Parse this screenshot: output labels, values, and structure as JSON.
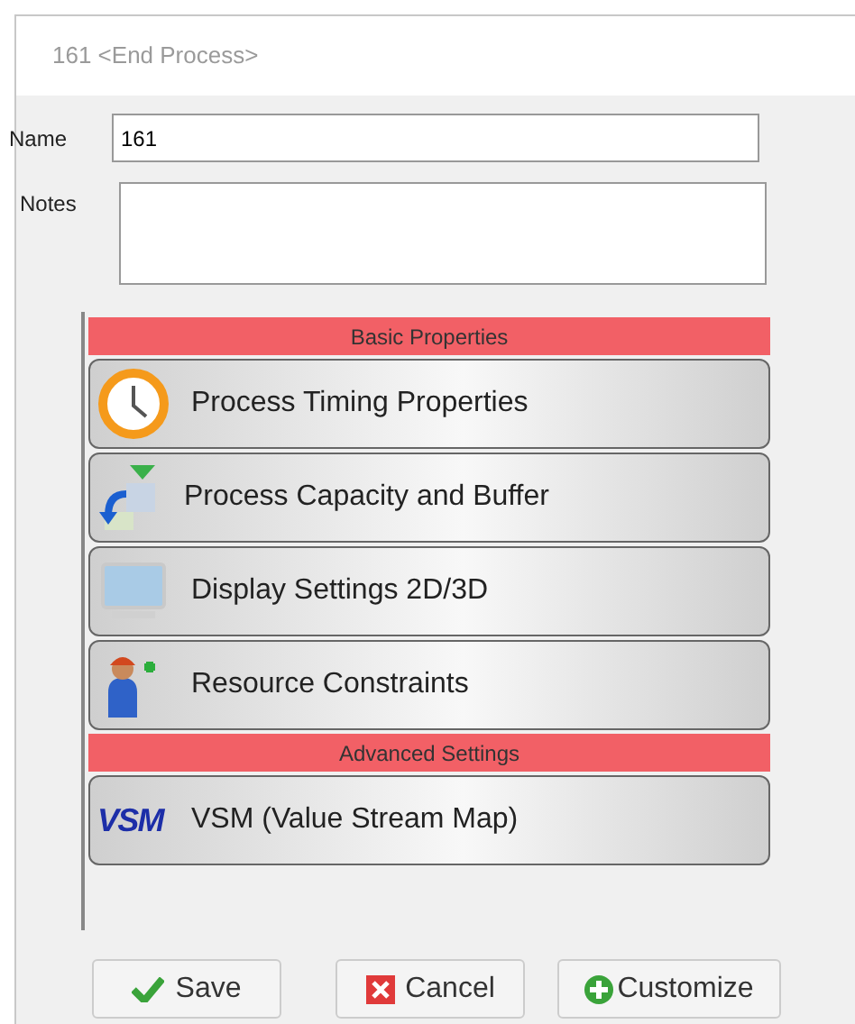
{
  "window": {
    "title": "161 <End Process>"
  },
  "form": {
    "name_label": "Name",
    "name_value": "161",
    "notes_label": "Notes"
  },
  "sections": [
    {
      "title": "Basic Properties",
      "items": [
        {
          "label": "Process Timing Properties",
          "kind": "clock"
        },
        {
          "label": "Process Capacity and Buffer",
          "kind": "capacity"
        },
        {
          "label": "Display Settings 2D/3D",
          "kind": "monitor"
        },
        {
          "label": "Resource Constraints",
          "kind": "worker"
        }
      ]
    },
    {
      "title": "Advanced Settings",
      "items": [
        {
          "label": "VSM (Value Stream Map)",
          "kind": "vsm",
          "icon_text": "VSM"
        }
      ]
    }
  ],
  "buttons": [
    {
      "label": "Save",
      "kind": "check"
    },
    {
      "label": "Cancel",
      "kind": "cross"
    },
    {
      "label": "Customize",
      "kind": "plus"
    }
  ]
}
